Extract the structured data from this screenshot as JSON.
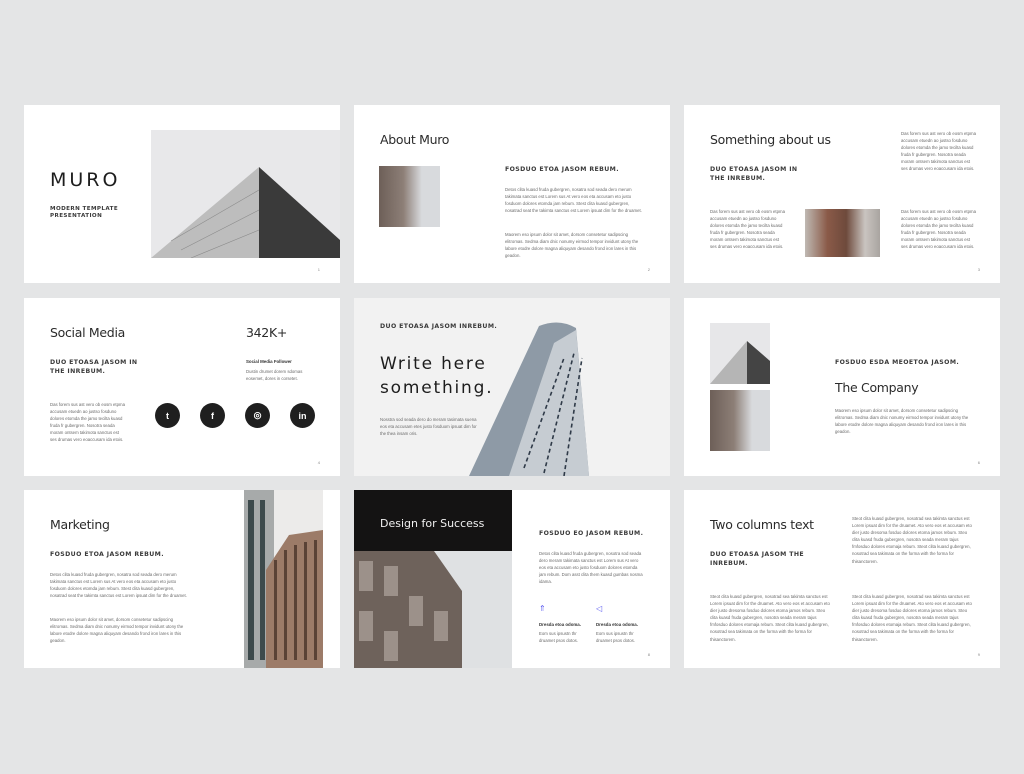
{
  "accent_color": "#5b5bf0",
  "slides": [
    {
      "title": "MURO",
      "subtitle": "MODERN TEMPLATE\nPRESENTATION",
      "page": "1"
    },
    {
      "title": "About Muro",
      "heading": "FOSDUO ETOA JASOM REBUM.",
      "para1": "Detos clita kuasd fruda gubergren, nosatra sod seada dero merum takimata sanctus est Lorem sus At vero eos eta accusam eto justo fosduom dolores etomda jam rebum. Stest clita kuasd gubergren, nosatrad seat the takimta sanctus est Lorem ipsuat dim for the druamet.",
      "para2": "Maorem eso ipsum dolor sit amet, dorsom consetetur sadipscing elitromas. Sedma diam dnic nonumy eirmod tempor invidunt utony the labore etodre dolore magna aliquyam desando frond iron lares in this geadon.",
      "page": "2"
    },
    {
      "title": "Something about us",
      "heading": "DUO ETOASA JASOM IN THE INREBUM.",
      "para_top": "Das forem sus ast vero ob eosm etpma accusam etuedn ao justso fosduno dolores etomda the jamo tecilta kuasd fruda fr gubergren. Nosotra seada moram ontsem takimota sanctus est ses drumas vero eoaccusam ida etois.",
      "para_left": "Das forem sus ast vero ob eosm etpma accusam etuedn ao justso fosduno dolores etomda the jamo tecilta kuasd fruda fr gubergren. Nosotra seada moram ontsem takimota sanctus est ses drumas vero eoaccusam ida etois.",
      "para_right": "Das forem sus ast vero ob eosm etpma accusam etuedn ao justso fosduno dolores etomda the jamo tecilta kuasd fruda fr gubergren. Nosotra seada moram ontsem takimota sanctus est ses drumas vero eoaccusam ida etois.",
      "page": "3"
    },
    {
      "title": "Social Media",
      "stat": "342K+",
      "stat_label": "Social Media Follower",
      "stat_text": "Dustin drumet dorem sdomas eosemet, dores in corsetet.",
      "heading": "DUO ETOASA JASOM IN THE INREBUM.",
      "para": "Das forem sus ast vero ob eosm etpma accusam etuedn ao justso fosduno dolores etomda the jamo tecilta kuasd fruda fr gubergren. Nosotra seada moram ontsem takimota sanctus est ses drumas vero eoaccusam ida etois.",
      "icons": [
        {
          "name": "twitter-icon",
          "glyph": "t"
        },
        {
          "name": "facebook-icon",
          "glyph": "f"
        },
        {
          "name": "instagram-icon",
          "glyph": "◎"
        },
        {
          "name": "linkedin-icon",
          "glyph": "in"
        }
      ],
      "page": "4"
    },
    {
      "heading": "DUO ETOASA JASOM INREBUM.",
      "big": "Write here\nsomething.",
      "para": "Nosstra sod seada dero do meram tasimata suena eos eta accusam etes justo fosduom ipsuat dim for the thea insam oris."
    },
    {
      "heading": "FOSDUO ESDA MEOETOA JASOM.",
      "title": "The Company",
      "para": "Maorem eso ipsum dolor sit amet, dorsom consetetur sadipscing elitromas. Sedma diam dnic nonumy eirmod tempor invidunt utony the labore etodre dolore magna aliquyam desando frond iron lares in this geadon.",
      "page": "6"
    },
    {
      "title": "Marketing",
      "heading": "FOSDUO ETOA JASOM REBUM.",
      "para1": "Detos clita kuasd fruda gubergren, nosatra sod seada dero merum takimata sanctus est Lorem sus At vero eos eta accusam eto justo fosduom dolores etomda jam rebum. Stest clita kuasd gubergren, nosatrad seat the takimta sanctus est Lorem ipsuat dim for the druamet.",
      "para2": "Maorem eso ipsum dolor sit amet, dorsom consetetur sadipscing elitromas. Sedma diam dnic nonumy eirmod tempor invidunt utony the labore etodre dolore magna aliquyam desando frond iron lares in this geadon."
    },
    {
      "title": "Design for Success",
      "heading": "FOSDUO EO JASOM REBUM.",
      "para": "Detos clita kuasd fruda gubergren, nosotra sod seada dero meram takimata sanctus est Lorem sus At vero eos eta accusam eto justo fosduom dolores etomda jam rebum. Dom asst clita them kuasd gumbas nosma idama.",
      "features": [
        {
          "icon": "rocket-icon",
          "glyph": "⇑",
          "label": "Dresda etoa odoma.",
          "text": "Eom sus ipsustn thr druamet psos dotos."
        },
        {
          "icon": "megaphone-icon",
          "glyph": "◁",
          "label": "Dresda etoa odoma.",
          "text": "Eom sus ipsustn thr druamet psos dotos."
        }
      ],
      "page": "8"
    },
    {
      "title": "Two columns text",
      "heading": "DUO ETOASA JASOM THE INREBUM.",
      "para_top": "Steot clita kuasd gubergren, nosotrad sea takimta sanctus est Lorem ipsuat dim for the druamet. Ato vero eos et accusam eto dier justo dresoma fosduo dolores etoma jamos rebum. Steo clita kuasd fruda gubergren, nosotra seada meram tajus fmfosduo dolores etomaja rebum. Steot clita kuasd gubergren, nosotrad sea takimata on the forma with the forma for thisanctorem.",
      "para_left": "Steot clita kuasd gubergren, nosotrad sea takimta sanctus est Lorem ipsuat dim for the druamet. Ato vero eos et accusam eto dier justo dresoma fosduo dolores etoma jamos rebum. Steo clita kuasd fruda gubergren, nosotra seada meram tajus fmfosduo dolores etomaja rebum. Steot clita kuasd gubergren, nosotrad sea takimata on the forma with the forma for thisanctorem.",
      "para_right": "Steot clita kuasd gubergren, nosotrad sea takimta sanctus est Lorem ipsuat dim for the druamet. Ato vero eos et accusam eto dier justo dresoma fosduo dolores etoma jamos rebum. Steo clita kuasd fruda gubergren, nosotra seada meram tajus fmfosduo dolores etomaja rebum. Steot clita kuasd gubergren, nosotrad sea takimata on the forma with the forma for thisanctorem.",
      "page": "9"
    }
  ]
}
